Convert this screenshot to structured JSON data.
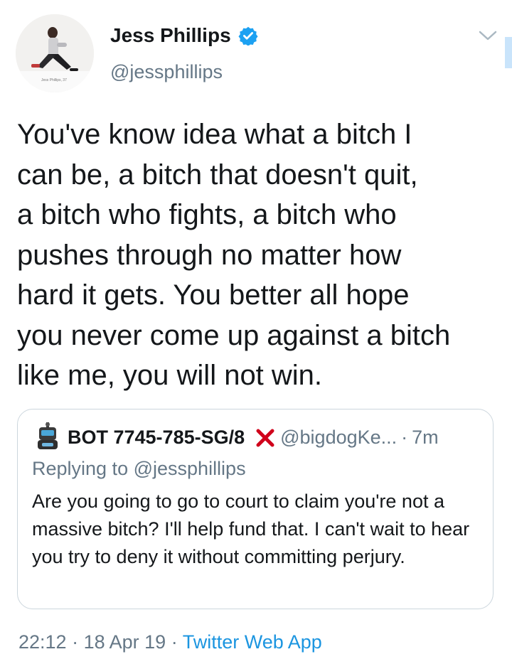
{
  "author": {
    "display_name": "Jess Phillips",
    "handle": "@jessphillips",
    "avatar_caption": "Jess Phillips, 37",
    "verified": true
  },
  "tweet": {
    "text": "You've know idea what a bitch I\ncan be, a bitch that doesn't quit,\na bitch who fights, a bitch who\npushes through no matter how\nhard it gets. You better all hope\nyou never come up against a bitch\nlike me, you will not win."
  },
  "quoted_tweet": {
    "display_name": "BOT 7745-785-SG/8",
    "handle": "@bigdogKe...",
    "separator": "·",
    "time": "7m",
    "replying_prefix": "Replying to",
    "replying_handle": "@jessphillips",
    "text": "Are you going to go to court to claim you're not a massive bitch? I'll help fund that. I can't wait to hear you try to deny it without committing perjury."
  },
  "meta": {
    "time": "22:12",
    "separator": "·",
    "date": "18 Apr 19",
    "app": "Twitter Web App"
  },
  "colors": {
    "text": "#14171a",
    "secondary": "#657786",
    "link": "#1b95e0",
    "verified": "#1da1f2",
    "border": "#ccd6dd",
    "x_mark": "#d0021b"
  },
  "icons": {
    "verified": "verified-badge-icon",
    "chevron": "chevron-down-icon",
    "x_mark": "red-x-icon"
  }
}
